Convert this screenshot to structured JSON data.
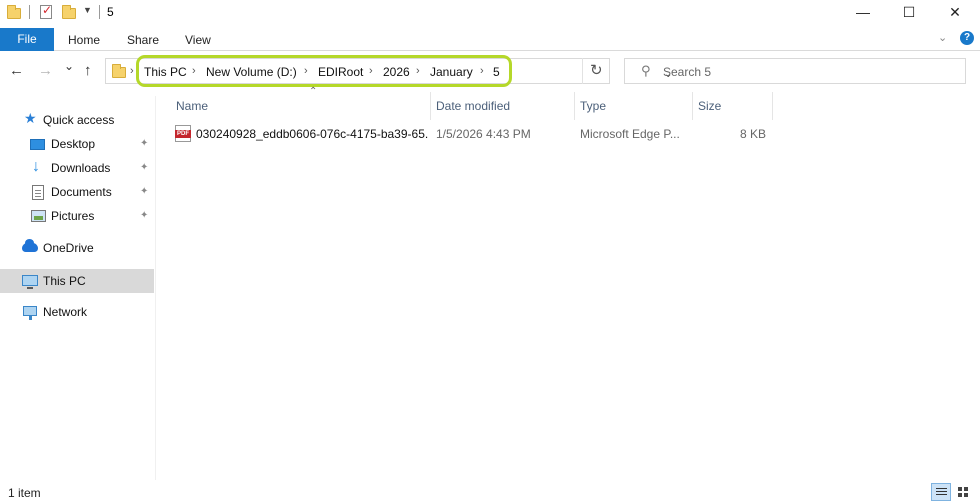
{
  "window": {
    "title": "5",
    "minimize_glyph": "—",
    "maximize_glyph": "☐",
    "close_glyph": "✕"
  },
  "ribbon": {
    "tabs": [
      {
        "label": "File"
      },
      {
        "label": "Home"
      },
      {
        "label": "Share"
      },
      {
        "label": "View"
      }
    ],
    "help_glyph": "?",
    "expand_glyph": "⌄"
  },
  "nav": {
    "back_glyph": "←",
    "forward_glyph": "→",
    "recent_glyph": "⌄",
    "up_glyph": "↑",
    "refresh_glyph": "↻",
    "address_drop_glyph": "⌄"
  },
  "address": {
    "crumbs": [
      "This PC",
      "New Volume (D:)",
      "EDIRoot",
      "2026",
      "January",
      "5"
    ],
    "highlight_color": "#b5d82a"
  },
  "search": {
    "placeholder": "Search 5",
    "icon": "search-icon"
  },
  "sidebar": {
    "items": [
      {
        "label": "Quick access",
        "icon": "star-icon"
      },
      {
        "label": "Desktop",
        "icon": "desktop-icon",
        "pinned": true
      },
      {
        "label": "Downloads",
        "icon": "download-icon",
        "pinned": true
      },
      {
        "label": "Documents",
        "icon": "documents-icon",
        "pinned": true
      },
      {
        "label": "Pictures",
        "icon": "pictures-icon",
        "pinned": true
      },
      {
        "label": "OneDrive",
        "icon": "cloud-icon"
      },
      {
        "label": "This PC",
        "icon": "computer-icon",
        "selected": true
      },
      {
        "label": "Network",
        "icon": "network-icon"
      }
    ],
    "pin_glyph": "📌"
  },
  "columns": [
    "Name",
    "Date modified",
    "Type",
    "Size"
  ],
  "files": [
    {
      "name": "030240928_eddb0606-076c-4175-ba39-65...",
      "date_modified": "1/5/2026 4:43 PM",
      "type": "Microsoft Edge P...",
      "size": "8 KB",
      "icon": "pdf-icon"
    }
  ],
  "status": {
    "item_count": "1 item"
  },
  "colors": {
    "accent": "#1979ca",
    "selected_bg": "#d9d9d9",
    "header_text": "#4c607a"
  }
}
